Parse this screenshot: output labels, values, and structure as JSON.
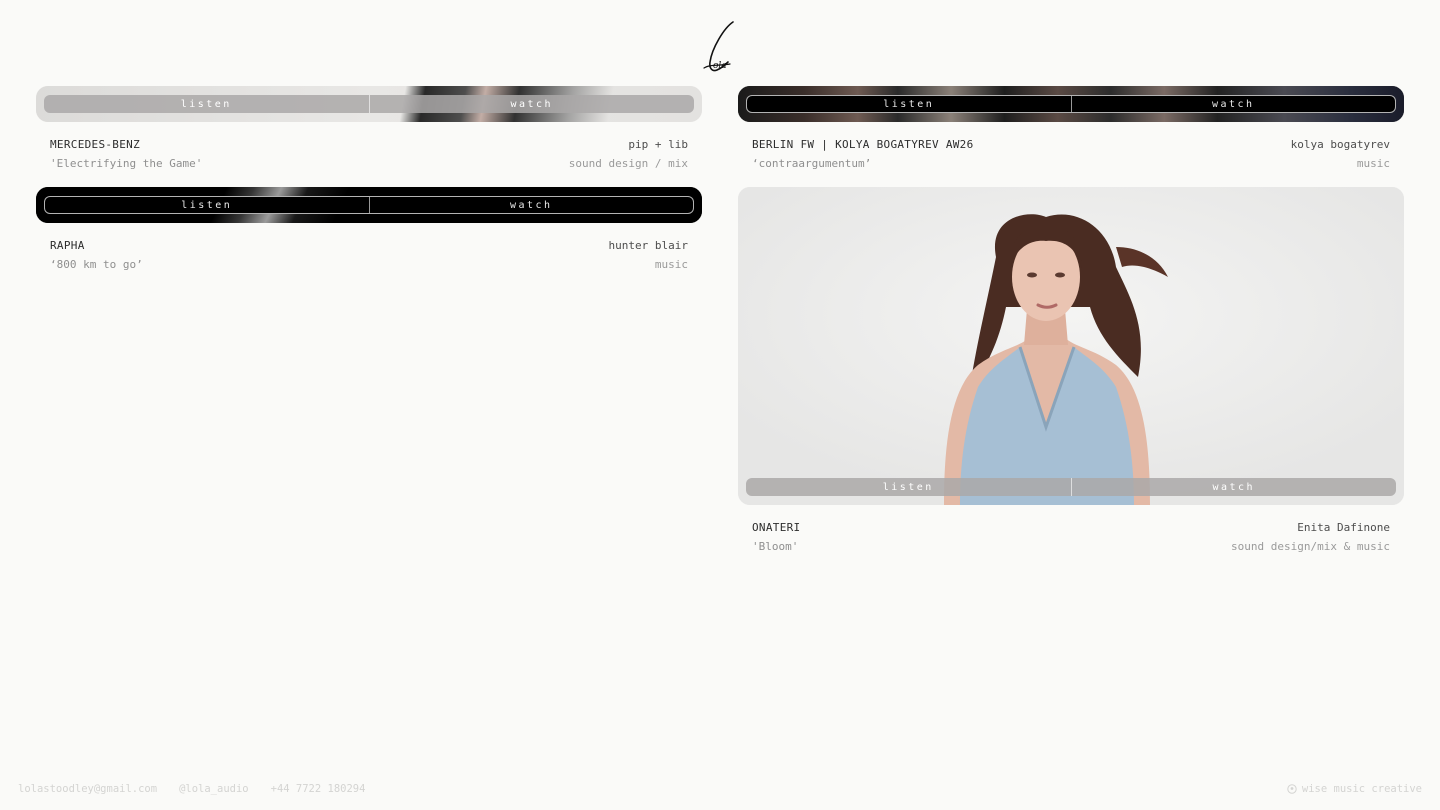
{
  "brand": {
    "logo_text": "Lola"
  },
  "projects": [
    {
      "client": "MERCEDES-BENZ",
      "director": "pip + lib",
      "title": "'Electrifying the Game'",
      "role": "sound design / mix",
      "listen_label": "listen",
      "watch_label": "watch"
    },
    {
      "client": "BERLIN FW | KOLYA BOGATYREV AW26",
      "director": "kolya bogatyrev",
      "title": "‘contraargumentum’",
      "role": "music",
      "listen_label": "listen",
      "watch_label": "watch"
    },
    {
      "client": "RAPHA",
      "director": "hunter blair",
      "title": "‘800 km to go’",
      "role": "music",
      "listen_label": "listen",
      "watch_label": "watch"
    },
    {
      "client": "ONATERI",
      "director": "Enita Dafinone",
      "title": "'Bloom'",
      "role": "sound design/mix & music",
      "listen_label": "listen",
      "watch_label": "watch"
    }
  ],
  "footer": {
    "email": "lolastoodley@gmail.com",
    "instagram": "@lola_audio",
    "phone": "+44 7722 180294",
    "credit": "wise music creative"
  }
}
